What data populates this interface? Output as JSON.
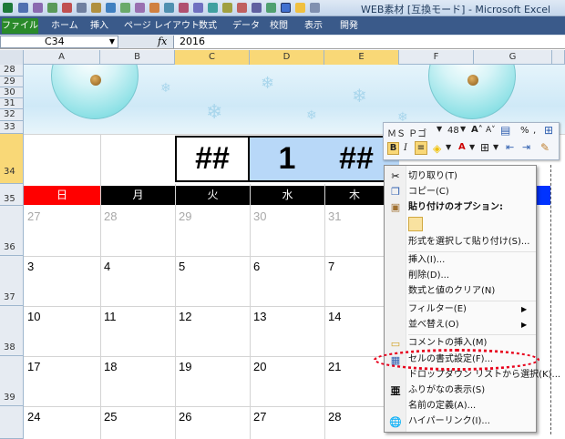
{
  "window": {
    "title": "WEB素材 [互換モード] - Microsoft Excel"
  },
  "ribbon": {
    "tabs": [
      "ファイル",
      "ホーム",
      "挿入",
      "ページ レイアウト",
      "数式",
      "データ",
      "校閲",
      "表示",
      "開発"
    ]
  },
  "formula_bar": {
    "cell_ref": "C34",
    "fx": "fx",
    "value": "2016"
  },
  "columns": [
    "A",
    "B",
    "C",
    "D",
    "E",
    "F",
    "G"
  ],
  "rows": [
    "28",
    "29",
    "30",
    "31",
    "32",
    "33",
    "34",
    "35",
    "36",
    "37",
    "38",
    "39"
  ],
  "calendar": {
    "header_cells": [
      "##",
      "1",
      "##"
    ],
    "weekdays": [
      "日",
      "月",
      "火",
      "水",
      "木"
    ],
    "weekday_colors": {
      "sunday": "#ff0000",
      "other": "#000000"
    },
    "weeks": [
      [
        "27",
        "28",
        "29",
        "30",
        "31"
      ],
      [
        "3",
        "4",
        "5",
        "6",
        "7"
      ],
      [
        "10",
        "11",
        "12",
        "13",
        "14"
      ],
      [
        "17",
        "18",
        "19",
        "20",
        "21"
      ],
      [
        "24",
        "25",
        "26",
        "27",
        "28"
      ]
    ]
  },
  "mini_toolbar": {
    "font": "ＭＳ Ｐゴ",
    "size": "48",
    "percent": "%",
    "bold": "B",
    "italic": "I",
    "font_color": "A"
  },
  "context_menu": {
    "cut": "切り取り(T)",
    "copy": "コピー(C)",
    "paste_options": "貼り付けのオプション:",
    "paste_special": "形式を選択して貼り付け(S)...",
    "insert": "挿入(I)...",
    "delete": "削除(D)...",
    "clear": "数式と値のクリア(N)",
    "filter": "フィルター(E)",
    "sort": "並べ替え(O)",
    "comment": "コメントの挿入(M)",
    "format_cells": "セルの書式設定(F)...",
    "dropdown": "ドロップダウン リストから選択(K)...",
    "phonetic": "ふりがなの表示(S)",
    "define_name": "名前の定義(A)...",
    "hyperlink": "ハイパーリンク(I)..."
  },
  "colors": {
    "highlight_oval": "#e8001c",
    "selected_header": "#f9d877",
    "selected_cell": "#b8d8f8"
  }
}
